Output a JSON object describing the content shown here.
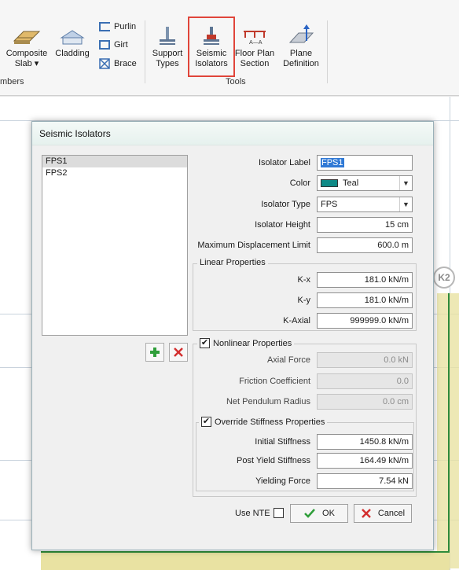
{
  "ribbon": {
    "members_group_label": "mbers",
    "tools_group_label": "Tools",
    "composite_slab": {
      "line1": "Composite",
      "line2": "Slab"
    },
    "cladding": "Cladding",
    "purlin": "Purlin",
    "girt": "Girt",
    "brace": "Brace",
    "support_types": {
      "line1": "Support",
      "line2": "Types"
    },
    "seismic_isolators": {
      "line1": "Seismic",
      "line2": "Isolators"
    },
    "floor_plan_section": {
      "line1": "Floor Plan",
      "line2": "Section"
    },
    "plane_definition": {
      "line1": "Plane",
      "line2": "Definition"
    },
    "section_glyph": "A—A"
  },
  "canvas": {
    "grid_label": "K2"
  },
  "dialog": {
    "title": "Seismic Isolators",
    "isolators": [
      "FPS1",
      "FPS2"
    ],
    "selected_index": 0,
    "isolator_label": {
      "label": "Isolator Label",
      "value": "FPS1"
    },
    "color": {
      "label": "Color",
      "value": "Teal",
      "swatch": "#0f8a86"
    },
    "isolator_type": {
      "label": "Isolator Type",
      "value": "FPS"
    },
    "isolator_height": {
      "label": "Isolator Height",
      "value": "15 cm"
    },
    "max_displacement": {
      "label": "Maximum Displacement Limit",
      "value": "600.0 m"
    },
    "linear": {
      "title": "Linear Properties",
      "kx": {
        "label": "K-x",
        "value": "181.0 kN/m"
      },
      "ky": {
        "label": "K-y",
        "value": "181.0 kN/m"
      },
      "kaxial": {
        "label": "K-Axial",
        "value": "999999.0 kN/m"
      }
    },
    "nonlinear": {
      "title": "Nonlinear Properties",
      "checked": true,
      "axial_force": {
        "label": "Axial Force",
        "value": "0.0 kN"
      },
      "friction": {
        "label": "Friction Coefficient",
        "value": "0.0"
      },
      "pendulum": {
        "label": "Net Pendulum Radius",
        "value": "0.0 cm"
      },
      "override": {
        "title": "Override Stiffness Properties",
        "checked": true,
        "initial": {
          "label": "Initial Stiffness",
          "value": "1450.8 kN/m"
        },
        "post_yield": {
          "label": "Post Yield Stiffness",
          "value": "164.49 kN/m"
        },
        "yielding": {
          "label": "Yielding Force",
          "value": "7.54 kN"
        }
      }
    },
    "use_nte": {
      "label": "Use NTE",
      "checked": false
    },
    "ok_label": "OK",
    "cancel_label": "Cancel"
  },
  "colors": {
    "accent_highlight": "#e0453a",
    "add_green": "#2f9e3a",
    "delete_red": "#d32f2f"
  }
}
